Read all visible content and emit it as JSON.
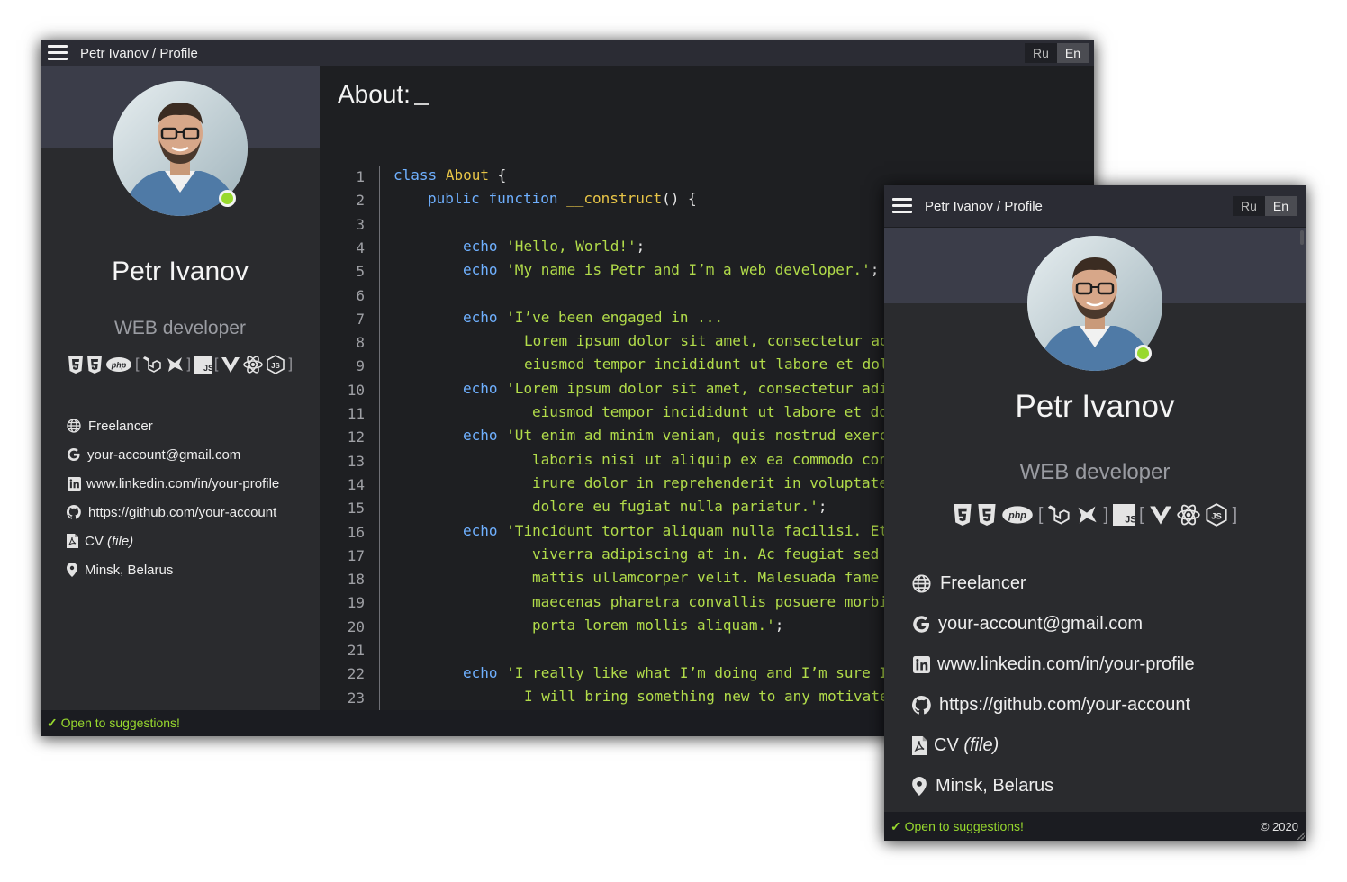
{
  "title": "Petr Ivanov / Profile",
  "lang": {
    "ru": "Ru",
    "en": "En"
  },
  "profile": {
    "name": "Petr Ivanov",
    "role": "WEB developer"
  },
  "skills": [
    "html5-icon",
    "css3-icon",
    "php-icon",
    "laravel-icon",
    "symfony-icon",
    "js-icon",
    "vue-icon",
    "react-icon",
    "nodejs-icon"
  ],
  "contacts": {
    "status": "Freelancer",
    "email": "your-account@gmail.com",
    "linkedin": "www.linkedin.com/in/your-profile",
    "github": "https://github.com/your-account",
    "cv": "CV",
    "cv_file": "(file)",
    "location": "Minsk, Belarus"
  },
  "footer": {
    "open": "Open to suggestions!",
    "copyright": "© 2020",
    "check": "✓"
  },
  "about": {
    "title": "About:",
    "line_numbers": [
      "1",
      "2",
      "3",
      "4",
      "5",
      "6",
      "7",
      "8",
      "9",
      "10",
      "11",
      "12",
      "13",
      "14",
      "15",
      "16",
      "17",
      "18",
      "19",
      "20",
      "21",
      "22",
      "23"
    ],
    "code": {
      "l1_kw": "class",
      "l1_cls": "About",
      "l1_p": " {",
      "l2_kw1": "public",
      "l2_kw2": "function",
      "l2_fn": "__construct",
      "l2_p": "() {",
      "echo": "echo",
      "l4": "'Hello, World!'",
      "l4_end": ";",
      "l5": "'My name is Petr and I’m a web developer.'",
      "l5_end": ";",
      "l7": "'I’ve been engaged in ...",
      "l8": "Lorem ipsum dolor sit amet, consectetur ad",
      "l9": "eiusmod tempor incididunt ut labore et dol",
      "l10": "'Lorem ipsum dolor sit amet, consectetur adi",
      "l11": "eiusmod tempor incididunt ut labore et do",
      "l12": "'Ut enim ad minim veniam, quis nostrud exerc",
      "l13": "laboris nisi ut aliquip ex ea commodo con",
      "l14": "irure dolor in reprehenderit in voluptate",
      "l15": "dolore eu fugiat nulla pariatur.'",
      "l15_end": ";",
      "l16": "'Tincidunt tortor aliquam nulla facilisi. Et",
      "l17": "viverra adipiscing at in. Ac feugiat sed",
      "l18": "mattis ullamcorper velit. Malesuada fame",
      "l19": "maecenas pharetra convallis posuere morbi",
      "l20": "porta lorem mollis aliquam.'",
      "l20_end": ";",
      "l22": "'I really like what I’m doing and I’m sure I",
      "l23": "I will bring something new to any motivate"
    }
  },
  "colors": {
    "accent": "#98d92e",
    "keyword": "#6fb0ff",
    "class": "#e8c547",
    "string": "#b2dc4a"
  }
}
